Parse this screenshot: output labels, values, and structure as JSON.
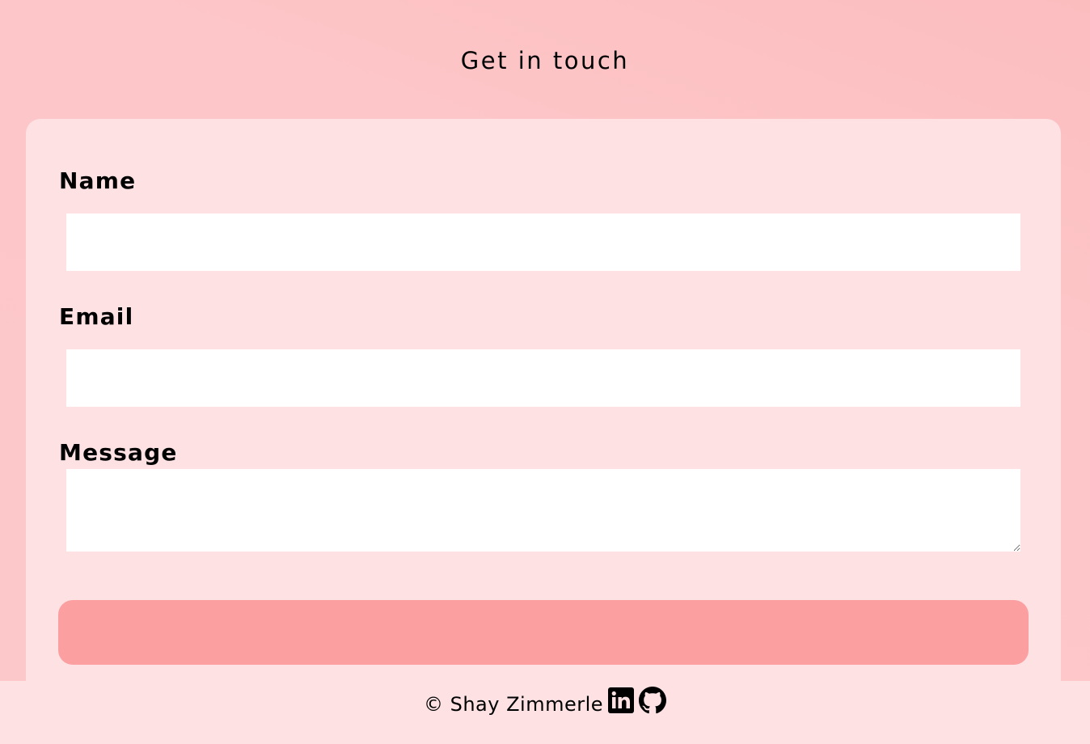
{
  "page": {
    "title": "Get in touch"
  },
  "form": {
    "name_label": "Name",
    "email_label": "Email",
    "message_label": "Message",
    "name_value": "",
    "email_value": "",
    "message_value": "",
    "submit_label": ""
  },
  "footer": {
    "copyright": "© Shay Zimmerle",
    "icons": [
      "linkedin-icon",
      "github-icon"
    ]
  },
  "colors": {
    "background": "#fdc7c9",
    "card": "#fde1e3",
    "button": "#fb9fa0",
    "input": "#ffffff"
  }
}
